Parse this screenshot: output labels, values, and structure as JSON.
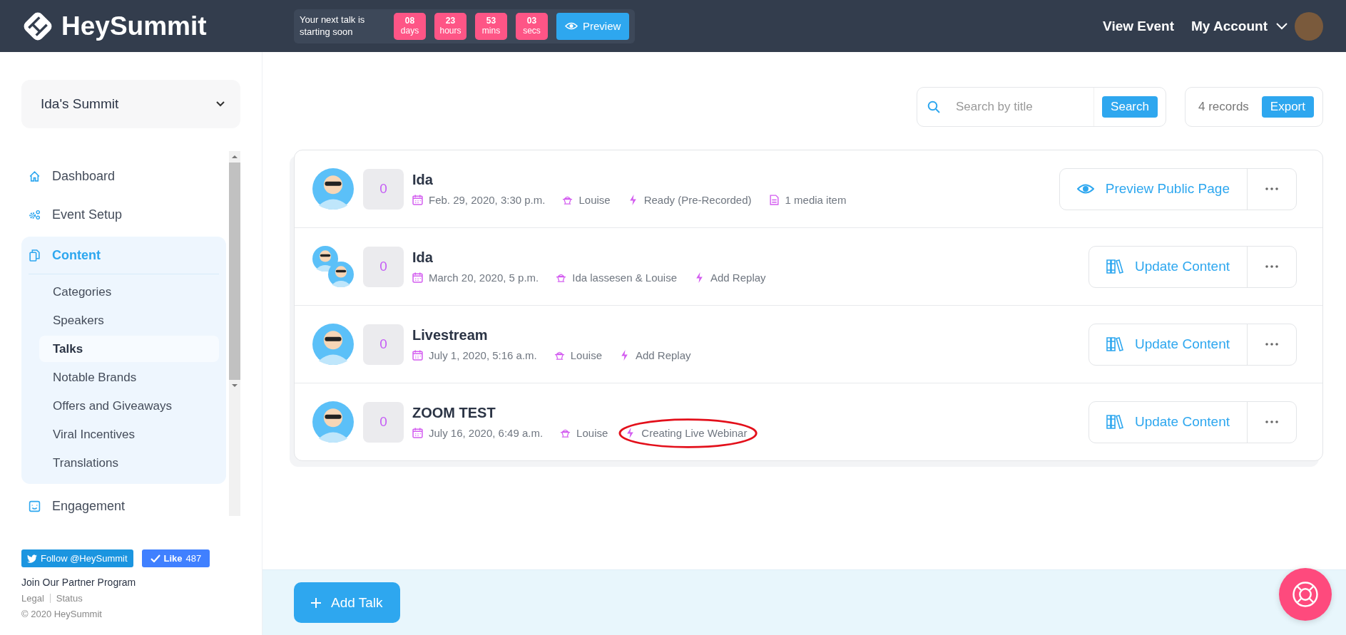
{
  "header": {
    "logo": "HeySummit",
    "countdown": {
      "label": "Your next talk is starting soon",
      "units": [
        {
          "value": "08",
          "unit": "days"
        },
        {
          "value": "23",
          "unit": "hours"
        },
        {
          "value": "53",
          "unit": "mins"
        },
        {
          "value": "03",
          "unit": "secs"
        }
      ],
      "preview_button": "Preview"
    },
    "view_event": "View Event",
    "account": "My Account"
  },
  "sidebar": {
    "summit": "Ida's Summit",
    "nav": [
      {
        "label": "Dashboard",
        "kind": "home",
        "selected": false,
        "expanded": false
      },
      {
        "label": "Event Setup",
        "kind": "gears",
        "selected": false,
        "expanded": false
      },
      {
        "label": "Content",
        "kind": "copy",
        "selected": true,
        "expanded": true,
        "children": [
          {
            "label": "Categories",
            "selected": false
          },
          {
            "label": "Speakers",
            "selected": false
          },
          {
            "label": "Talks",
            "selected": true
          },
          {
            "label": "Notable Brands",
            "selected": false
          },
          {
            "label": "Offers and Giveaways",
            "selected": false
          },
          {
            "label": "Viral Incentives",
            "selected": false
          },
          {
            "label": "Translations",
            "selected": false
          }
        ]
      },
      {
        "label": "Engagement",
        "kind": "smile",
        "selected": false,
        "expanded": false
      }
    ],
    "follow_button": "Follow @HeySummit",
    "like_button": "Like",
    "like_count": "487",
    "partner_link": "Join Our Partner Program",
    "legal_link": "Legal",
    "status_link": "Status",
    "copyright": "© 2020 HeySummit"
  },
  "toolbar": {
    "search": {
      "placeholder": "Search by title",
      "button": "Search"
    },
    "records": "4 records",
    "export_button": "Export"
  },
  "talks": [
    {
      "title": "Ida",
      "count": "0",
      "group_avatar": false,
      "action": {
        "kind": "preview",
        "label": "Preview Public Page"
      },
      "meta": [
        {
          "kind": "date",
          "text": "Feb. 29, 2020, 3:30 p.m.",
          "circled": false
        },
        {
          "kind": "speaker",
          "text": "Louise",
          "circled": false
        },
        {
          "kind": "status",
          "text": "Ready (Pre-Recorded)",
          "circled": false
        },
        {
          "kind": "media",
          "text": "1 media item",
          "circled": false
        }
      ]
    },
    {
      "title": "Ida",
      "count": "0",
      "group_avatar": true,
      "action": {
        "kind": "update",
        "label": "Update Content"
      },
      "meta": [
        {
          "kind": "date",
          "text": "March 20, 2020, 5 p.m.",
          "circled": false
        },
        {
          "kind": "speaker",
          "text": "Ida lassesen & Louise",
          "circled": false
        },
        {
          "kind": "status",
          "text": "Add Replay",
          "circled": false
        }
      ]
    },
    {
      "title": "Livestream",
      "count": "0",
      "group_avatar": false,
      "action": {
        "kind": "update",
        "label": "Update Content"
      },
      "meta": [
        {
          "kind": "date",
          "text": "July 1, 2020, 5:16 a.m.",
          "circled": false
        },
        {
          "kind": "speaker",
          "text": "Louise",
          "circled": false
        },
        {
          "kind": "status",
          "text": "Add Replay",
          "circled": false
        }
      ]
    },
    {
      "title": "ZOOM TEST",
      "count": "0",
      "group_avatar": false,
      "action": {
        "kind": "update",
        "label": "Update Content"
      },
      "meta": [
        {
          "kind": "date",
          "text": "July 16, 2020, 6:49 a.m.",
          "circled": false
        },
        {
          "kind": "speaker",
          "text": "Louise",
          "circled": false
        },
        {
          "kind": "status",
          "text": "Creating Live Webinar",
          "circled": true
        }
      ]
    }
  ],
  "add_button": "Add Talk"
}
